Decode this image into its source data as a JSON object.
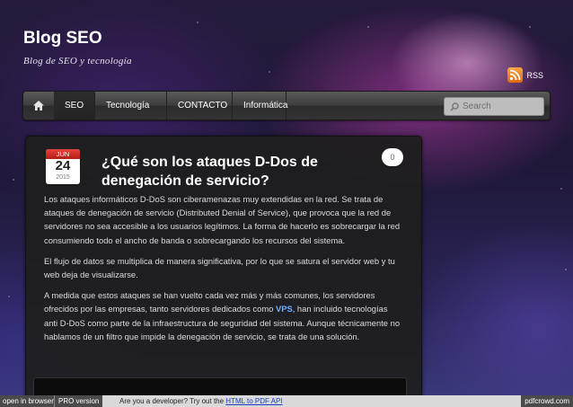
{
  "site": {
    "title": "Blog SEO",
    "description": "Blog de SEO y tecnología",
    "rss_label": "RSS"
  },
  "nav": {
    "items": [
      {
        "label": "SEO"
      },
      {
        "label": "Tecnología"
      },
      {
        "label": "CONTACTO"
      },
      {
        "label": "Informática"
      }
    ],
    "search_placeholder": "Search"
  },
  "post": {
    "date": {
      "month": "JUN",
      "day": "24",
      "year": "2015"
    },
    "title": "¿Qué son los ataques D-Dos de denegación de servicio?",
    "comment_count": "0",
    "paragraphs": {
      "p1": "Los ataques informáticos D-DoS son ciberamenazas muy extendidas en la red. Se trata de ataques de denegación de servicio (Distributed Denial of Service), que provoca que la red de servidores no sea accesible a los usuarios legítimos. La forma de hacerlo es sobrecargar la red consumiendo todo el ancho de banda o sobrecargando los recursos del sistema.",
      "p2": "El flujo de datos se multiplica de manera significativa, por lo que se satura el servidor web y tu web deja de visualizarse.",
      "p3_before": "A medida que estos ataques se han vuelto cada vez más y más comunes, los servidores ofrecidos por las empresas, tanto servidores dedicados como ",
      "p3_link": "VPS",
      "p3_after": ", han incluido tecnologías anti D-DoS como parte de la infraestructura de seguridad del sistema. Aunque técnicamente no hablamos de un filtro que impide la denegación de servicio, se trata de una solución."
    }
  },
  "pdf_footer": {
    "open_in_browser": "open in browser",
    "pro_version": "PRO version",
    "promo_text": "Are you a developer? Try out the ",
    "promo_link": "HTML to PDF API",
    "brand": "pdfcrowd.com"
  },
  "colors": {
    "accent_link": "#6fb1ff",
    "date_header": "#d0261f",
    "rss_orange": "#f08a24"
  }
}
